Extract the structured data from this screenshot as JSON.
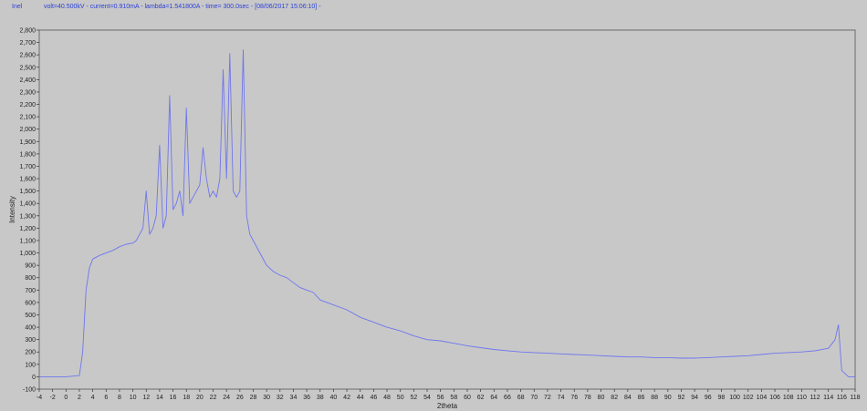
{
  "header": {
    "app_name": "Inel",
    "info": "volt=40.500kV - current=0.910mA - lambda=1.541800A - time=  300.0sec - [08/06/2017 15:06:10] -"
  },
  "colors": {
    "background": "#c8c8c8",
    "plot_area": "#c8c8c8",
    "series": "#6f76ee",
    "text": "#2b3fd6"
  },
  "chart_data": {
    "type": "line",
    "title": "",
    "xlabel": "2theta",
    "ylabel": "Intensity",
    "xlim": [
      -4,
      118
    ],
    "ylim": [
      -100,
      2800
    ],
    "x_ticks": [
      -4,
      -2,
      0,
      2,
      4,
      6,
      8,
      10,
      12,
      14,
      16,
      18,
      20,
      22,
      24,
      26,
      28,
      30,
      32,
      34,
      36,
      38,
      40,
      42,
      44,
      46,
      48,
      50,
      52,
      54,
      56,
      58,
      60,
      62,
      64,
      66,
      68,
      70,
      72,
      74,
      76,
      78,
      80,
      82,
      84,
      86,
      88,
      90,
      92,
      94,
      96,
      98,
      100,
      102,
      104,
      106,
      108,
      110,
      112,
      114,
      116,
      118
    ],
    "y_ticks": [
      -100,
      0,
      100,
      200,
      300,
      400,
      500,
      600,
      700,
      800,
      900,
      1000,
      1100,
      1200,
      1300,
      1400,
      1500,
      1600,
      1700,
      1800,
      1900,
      2000,
      2100,
      2200,
      2300,
      2400,
      2500,
      2600,
      2700,
      2800
    ],
    "y_tick_labels": [
      "-100",
      "0",
      "100",
      "200",
      "300",
      "400",
      "500",
      "600",
      "700",
      "800",
      "900",
      "1,000",
      "1,100",
      "1,200",
      "1,300",
      "1,400",
      "1,500",
      "1,600",
      "1,700",
      "1,800",
      "1,900",
      "2,000",
      "2,100",
      "2,200",
      "2,300",
      "2,400",
      "2,500",
      "2,600",
      "2,700",
      "2,800"
    ],
    "grid": false,
    "series": [
      {
        "x": [
          -4,
          -2,
          0,
          2,
          2.5,
          3,
          3.5,
          4,
          5,
          6,
          7,
          8,
          9,
          10,
          10.5,
          11,
          11.5,
          12,
          12.5,
          13,
          13.5,
          14,
          14.5,
          15,
          15.5,
          16,
          16.5,
          17,
          17.5,
          18,
          18.5,
          19,
          19.5,
          20,
          20.5,
          21,
          21.5,
          22,
          22.5,
          23,
          23.5,
          24,
          24.5,
          25,
          25.5,
          26,
          26.5,
          27,
          27.5,
          28,
          29,
          30,
          31,
          32,
          33,
          34,
          35,
          36,
          37,
          38,
          40,
          42,
          44,
          46,
          48,
          50,
          52,
          54,
          56,
          58,
          60,
          62,
          64,
          66,
          68,
          70,
          72,
          74,
          76,
          78,
          80,
          82,
          84,
          86,
          88,
          90,
          92,
          94,
          96,
          98,
          100,
          102,
          104,
          106,
          108,
          110,
          112,
          114,
          115,
          115.5,
          116,
          117,
          118
        ],
        "y": [
          0,
          0,
          0,
          10,
          200,
          700,
          880,
          950,
          980,
          1000,
          1020,
          1050,
          1070,
          1080,
          1100,
          1150,
          1200,
          1500,
          1150,
          1200,
          1300,
          1870,
          1200,
          1300,
          2270,
          1350,
          1400,
          1500,
          1300,
          2170,
          1400,
          1450,
          1500,
          1550,
          1850,
          1600,
          1450,
          1500,
          1450,
          1600,
          2480,
          1600,
          2610,
          1500,
          1450,
          1500,
          2640,
          1300,
          1150,
          1100,
          1000,
          900,
          850,
          820,
          800,
          760,
          720,
          700,
          680,
          620,
          580,
          540,
          480,
          440,
          400,
          370,
          330,
          300,
          290,
          270,
          250,
          235,
          220,
          210,
          200,
          195,
          190,
          185,
          180,
          175,
          170,
          165,
          160,
          160,
          155,
          155,
          150,
          150,
          155,
          160,
          165,
          170,
          180,
          190,
          195,
          200,
          210,
          230,
          300,
          420,
          50,
          0,
          0
        ]
      }
    ]
  }
}
